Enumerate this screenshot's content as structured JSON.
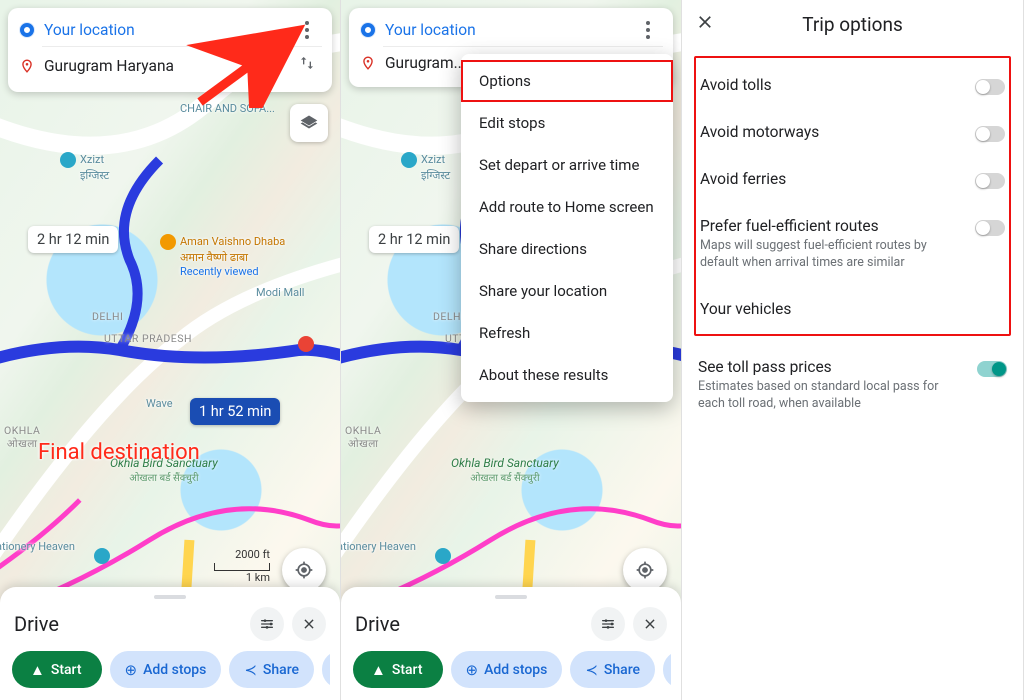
{
  "panel1": {
    "origin": "Your location",
    "destination": "Gurugram Haryana",
    "time_alt": "2 hr 12 min",
    "time_sel": "1 hr 52 min",
    "annotation": "Final destination",
    "scale_top": "2000 ft",
    "scale_bot": "1 km",
    "sheet_title": "Drive",
    "chip_start": "Start",
    "chip_add": "Add stops",
    "chip_share": "Share",
    "poi_chair": "CHAIR AND SOFA...",
    "poi_xzizt": "Xzizt",
    "poi_xzizt_hi": "इग्जिस्ट",
    "poi_dhaba": "Aman Vaishno Dhaba",
    "poi_dhaba_hi": "अमान वैष्णो ढाबा",
    "poi_dhaba_sub": "Recently viewed",
    "poi_modi": "Modi Mall",
    "district_delhi": "DELHI",
    "district_up": "UTTAR PRADESH",
    "district_okhla": "OKHLA",
    "district_okhla_hi": "ओखला",
    "park_name": "Okhla Bird Sanctuary",
    "park_name_hi": "ओखला बर्ड सैंक्चुरी",
    "poi_heaven": "ationery Heaven",
    "poi_wave": "Wave"
  },
  "panel2": {
    "origin": "Your location",
    "destination": "Gurugram...",
    "menu": {
      "options": "Options",
      "edit": "Edit stops",
      "depart": "Set depart or arrive time",
      "addroute": "Add route to Home screen",
      "sharedir": "Share directions",
      "shareloc": "Share your location",
      "refresh": "Refresh",
      "about": "About these results"
    },
    "time_alt": "2 hr 12 min",
    "sheet_title": "Drive",
    "chip_start": "Start",
    "chip_add": "Add stops",
    "chip_share": "Share"
  },
  "panel3": {
    "title": "Trip options",
    "tolls": "Avoid tolls",
    "motorways": "Avoid motorways",
    "ferries": "Avoid ferries",
    "fuel": "Prefer fuel-efficient routes",
    "fuel_sub": "Maps will suggest fuel-efficient routes by default when arrival times are similar",
    "vehicles": "Your vehicles",
    "tollpass": "See toll pass prices",
    "tollpass_sub": "Estimates based on standard local pass for each toll road, when available"
  }
}
